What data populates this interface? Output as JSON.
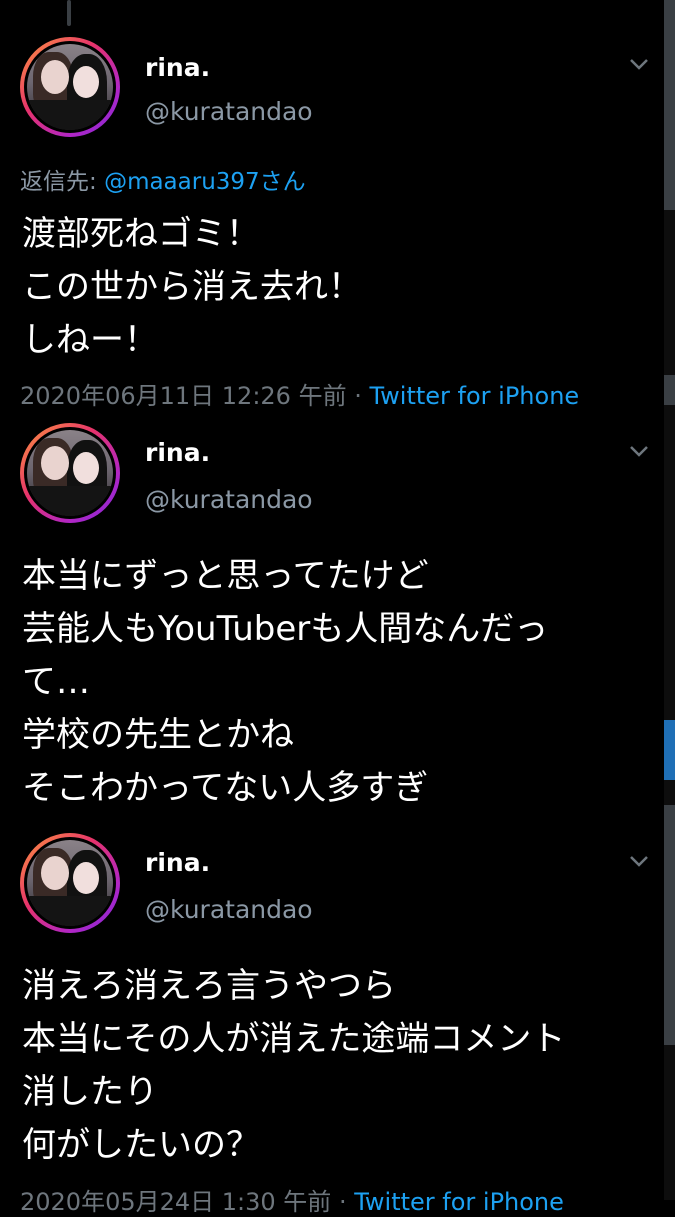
{
  "tweets": [
    {
      "name": "rina.",
      "handle": "@kuratandao",
      "reply_prefix": "返信先: ",
      "reply_to": "@maaaru397さん",
      "lines": [
        "渡部死ねゴミ！",
        "この世から消え去れ！",
        "しねー！"
      ],
      "timestamp": "2020年06月11日 12:26 午前",
      "separator": " · ",
      "source": "Twitter for iPhone"
    },
    {
      "name": "rina.",
      "handle": "@kuratandao",
      "lines": [
        "本当にずっと思ってたけど",
        "芸能人もYouTuberも人間なんだっ",
        "て…",
        "学校の先生とかね",
        "そこわかってない人多すぎ"
      ]
    },
    {
      "name": "rina.",
      "handle": "@kuratandao",
      "lines": [
        "消えろ消えろ言うやつら",
        "本当にその人が消えた途端コメント",
        "消したり",
        "何がしたいの？"
      ],
      "timestamp": "2020年05月24日 1:30 午前",
      "separator": " · ",
      "source": "Twitter for iPhone"
    }
  ],
  "colors": {
    "background": "#000000",
    "text": "#ffffff",
    "muted": "#8b98a5",
    "link": "#1da1f2"
  },
  "icons": [
    "chevron-down-icon",
    "avatar"
  ]
}
